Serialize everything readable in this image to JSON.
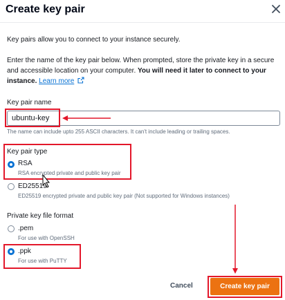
{
  "dialog": {
    "title": "Create key pair",
    "close_icon": "close-icon"
  },
  "intro": {
    "line1": "Key pairs allow you to connect to your instance securely.",
    "line2_part1": "Enter the name of the key pair below. When prompted, store the private key in a secure and accessible location on your computer. ",
    "line2_bold": "You will need it later to connect to your instance.",
    "learn_more": "Learn more",
    "external_icon": "external-link-icon"
  },
  "key_name": {
    "label": "Key pair name",
    "value": "ubuntu-key",
    "hint": "The name can include upto 255 ASCII characters. It can't include leading or trailing spaces."
  },
  "key_type": {
    "label": "Key pair type",
    "options": [
      {
        "label": "RSA",
        "description": "RSA encrypted private and public key pair",
        "checked": true
      },
      {
        "label": "ED25519",
        "description": "ED25519 encrypted private and public key pair (Not supported for Windows instances)",
        "checked": false
      }
    ]
  },
  "file_format": {
    "label": "Private key file format",
    "options": [
      {
        "label": ".pem",
        "description": "For use with OpenSSH",
        "checked": false
      },
      {
        "label": ".ppk",
        "description": "For use with PuTTY",
        "checked": true
      }
    ]
  },
  "footer": {
    "cancel_label": "Cancel",
    "create_label": "Create key pair"
  },
  "colors": {
    "accent": "#0972d3",
    "primary_button": "#ec7211",
    "annotation": "#e3172a"
  }
}
